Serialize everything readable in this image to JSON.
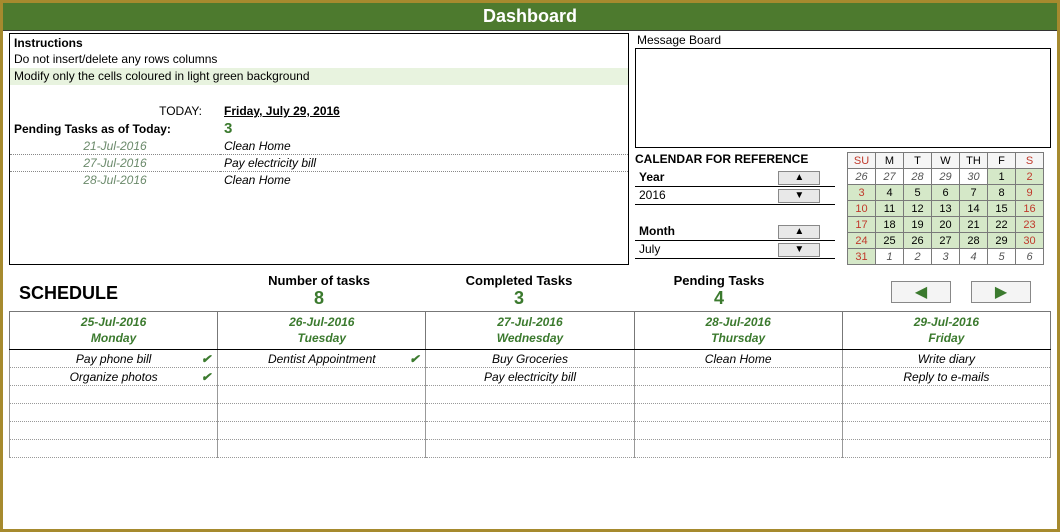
{
  "header": {
    "title": "Dashboard"
  },
  "instructions": {
    "title": "Instructions",
    "line1": "Do not insert/delete any rows columns",
    "line2": "Modify only the cells coloured in light green background"
  },
  "today": {
    "label": "TODAY:",
    "value": "Friday, July 29, 2016"
  },
  "pending_summary": {
    "label": "Pending Tasks as of Today:",
    "count": "3",
    "tasks": [
      {
        "date": "21-Jul-2016",
        "name": "Clean Home"
      },
      {
        "date": "27-Jul-2016",
        "name": "Pay electricity bill"
      },
      {
        "date": "28-Jul-2016",
        "name": "Clean Home"
      }
    ]
  },
  "message_board": {
    "label": "Message Board"
  },
  "calendar_ref": {
    "title": "CALENDAR FOR REFERENCE",
    "year_label": "Year",
    "year": "2016",
    "month_label": "Month",
    "month": "July",
    "days": [
      "SU",
      "M",
      "T",
      "W",
      "TH",
      "F",
      "S"
    ],
    "grid": [
      [
        {
          "v": "26",
          "cls": "prev red"
        },
        {
          "v": "27",
          "cls": "prev"
        },
        {
          "v": "28",
          "cls": "prev"
        },
        {
          "v": "29",
          "cls": "prev"
        },
        {
          "v": "30",
          "cls": "prev"
        },
        {
          "v": "1",
          "cls": "cur"
        },
        {
          "v": "2",
          "cls": "cur red"
        }
      ],
      [
        {
          "v": "3",
          "cls": "cur red"
        },
        {
          "v": "4",
          "cls": "cur"
        },
        {
          "v": "5",
          "cls": "cur"
        },
        {
          "v": "6",
          "cls": "cur"
        },
        {
          "v": "7",
          "cls": "cur"
        },
        {
          "v": "8",
          "cls": "cur"
        },
        {
          "v": "9",
          "cls": "cur red"
        }
      ],
      [
        {
          "v": "10",
          "cls": "cur red"
        },
        {
          "v": "11",
          "cls": "cur"
        },
        {
          "v": "12",
          "cls": "cur"
        },
        {
          "v": "13",
          "cls": "cur"
        },
        {
          "v": "14",
          "cls": "cur"
        },
        {
          "v": "15",
          "cls": "cur"
        },
        {
          "v": "16",
          "cls": "cur red"
        }
      ],
      [
        {
          "v": "17",
          "cls": "cur red"
        },
        {
          "v": "18",
          "cls": "cur"
        },
        {
          "v": "19",
          "cls": "cur"
        },
        {
          "v": "20",
          "cls": "cur"
        },
        {
          "v": "21",
          "cls": "cur"
        },
        {
          "v": "22",
          "cls": "cur"
        },
        {
          "v": "23",
          "cls": "cur red"
        }
      ],
      [
        {
          "v": "24",
          "cls": "cur red"
        },
        {
          "v": "25",
          "cls": "cur"
        },
        {
          "v": "26",
          "cls": "cur"
        },
        {
          "v": "27",
          "cls": "cur"
        },
        {
          "v": "28",
          "cls": "cur"
        },
        {
          "v": "29",
          "cls": "cur"
        },
        {
          "v": "30",
          "cls": "cur red"
        }
      ],
      [
        {
          "v": "31",
          "cls": "cur red"
        },
        {
          "v": "1",
          "cls": "next"
        },
        {
          "v": "2",
          "cls": "next"
        },
        {
          "v": "3",
          "cls": "next"
        },
        {
          "v": "4",
          "cls": "next"
        },
        {
          "v": "5",
          "cls": "next"
        },
        {
          "v": "6",
          "cls": "next"
        }
      ]
    ]
  },
  "metrics": {
    "schedule_title": "SCHEDULE",
    "num_label": "Number of tasks",
    "num_val": "8",
    "comp_label": "Completed Tasks",
    "comp_val": "3",
    "pend_label": "Pending Tasks",
    "pend_val": "4"
  },
  "schedule": {
    "columns": [
      {
        "date": "25-Jul-2016",
        "dow": "Monday"
      },
      {
        "date": "26-Jul-2016",
        "dow": "Tuesday"
      },
      {
        "date": "27-Jul-2016",
        "dow": "Wednesday"
      },
      {
        "date": "28-Jul-2016",
        "dow": "Thursday"
      },
      {
        "date": "29-Jul-2016",
        "dow": "Friday"
      }
    ],
    "rows": [
      [
        {
          "text": "Pay phone bill",
          "done": true
        },
        {
          "text": "Dentist Appointment",
          "done": true
        },
        {
          "text": "Buy Groceries",
          "done": false
        },
        {
          "text": "Clean Home",
          "done": false
        },
        {
          "text": "Write diary",
          "done": false
        }
      ],
      [
        {
          "text": "Organize photos",
          "done": true
        },
        {
          "text": "",
          "done": false
        },
        {
          "text": "Pay electricity bill",
          "done": false
        },
        {
          "text": "",
          "done": false
        },
        {
          "text": "Reply to e-mails",
          "done": false
        }
      ],
      [
        {
          "text": ""
        },
        {
          "text": ""
        },
        {
          "text": ""
        },
        {
          "text": ""
        },
        {
          "text": ""
        }
      ],
      [
        {
          "text": ""
        },
        {
          "text": ""
        },
        {
          "text": ""
        },
        {
          "text": ""
        },
        {
          "text": ""
        }
      ],
      [
        {
          "text": ""
        },
        {
          "text": ""
        },
        {
          "text": ""
        },
        {
          "text": ""
        },
        {
          "text": ""
        }
      ],
      [
        {
          "text": ""
        },
        {
          "text": ""
        },
        {
          "text": ""
        },
        {
          "text": ""
        },
        {
          "text": ""
        }
      ]
    ]
  },
  "icons": {
    "up": "▲",
    "down": "▼",
    "left": "◀",
    "right": "▶",
    "check": "✔"
  }
}
